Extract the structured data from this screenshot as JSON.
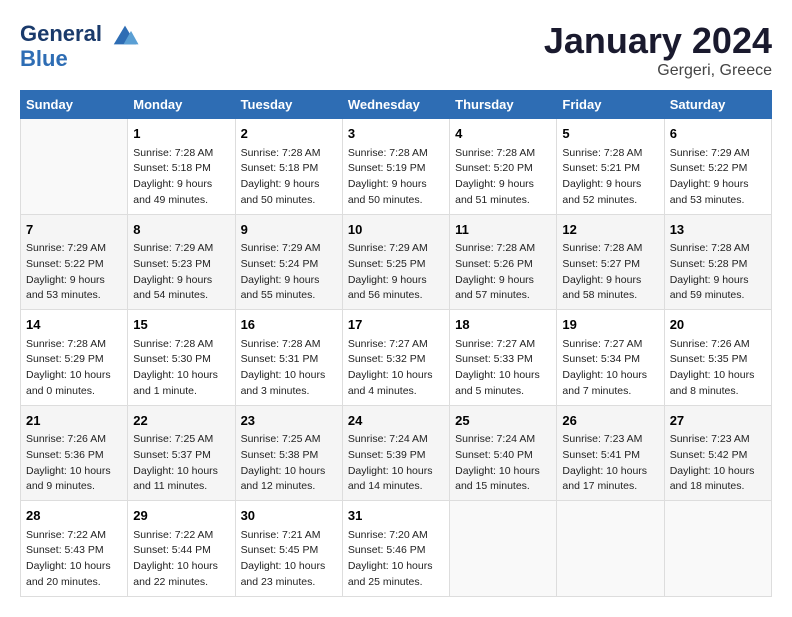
{
  "logo": {
    "line1": "General",
    "line2": "Blue"
  },
  "title": "January 2024",
  "subtitle": "Gergeri, Greece",
  "columns": [
    "Sunday",
    "Monday",
    "Tuesday",
    "Wednesday",
    "Thursday",
    "Friday",
    "Saturday"
  ],
  "weeks": [
    [
      {
        "day": "",
        "content": ""
      },
      {
        "day": "1",
        "content": "Sunrise: 7:28 AM\nSunset: 5:18 PM\nDaylight: 9 hours\nand 49 minutes."
      },
      {
        "day": "2",
        "content": "Sunrise: 7:28 AM\nSunset: 5:18 PM\nDaylight: 9 hours\nand 50 minutes."
      },
      {
        "day": "3",
        "content": "Sunrise: 7:28 AM\nSunset: 5:19 PM\nDaylight: 9 hours\nand 50 minutes."
      },
      {
        "day": "4",
        "content": "Sunrise: 7:28 AM\nSunset: 5:20 PM\nDaylight: 9 hours\nand 51 minutes."
      },
      {
        "day": "5",
        "content": "Sunrise: 7:28 AM\nSunset: 5:21 PM\nDaylight: 9 hours\nand 52 minutes."
      },
      {
        "day": "6",
        "content": "Sunrise: 7:29 AM\nSunset: 5:22 PM\nDaylight: 9 hours\nand 53 minutes."
      }
    ],
    [
      {
        "day": "7",
        "content": "Sunrise: 7:29 AM\nSunset: 5:22 PM\nDaylight: 9 hours\nand 53 minutes."
      },
      {
        "day": "8",
        "content": "Sunrise: 7:29 AM\nSunset: 5:23 PM\nDaylight: 9 hours\nand 54 minutes."
      },
      {
        "day": "9",
        "content": "Sunrise: 7:29 AM\nSunset: 5:24 PM\nDaylight: 9 hours\nand 55 minutes."
      },
      {
        "day": "10",
        "content": "Sunrise: 7:29 AM\nSunset: 5:25 PM\nDaylight: 9 hours\nand 56 minutes."
      },
      {
        "day": "11",
        "content": "Sunrise: 7:28 AM\nSunset: 5:26 PM\nDaylight: 9 hours\nand 57 minutes."
      },
      {
        "day": "12",
        "content": "Sunrise: 7:28 AM\nSunset: 5:27 PM\nDaylight: 9 hours\nand 58 minutes."
      },
      {
        "day": "13",
        "content": "Sunrise: 7:28 AM\nSunset: 5:28 PM\nDaylight: 9 hours\nand 59 minutes."
      }
    ],
    [
      {
        "day": "14",
        "content": "Sunrise: 7:28 AM\nSunset: 5:29 PM\nDaylight: 10 hours\nand 0 minutes."
      },
      {
        "day": "15",
        "content": "Sunrise: 7:28 AM\nSunset: 5:30 PM\nDaylight: 10 hours\nand 1 minute."
      },
      {
        "day": "16",
        "content": "Sunrise: 7:28 AM\nSunset: 5:31 PM\nDaylight: 10 hours\nand 3 minutes."
      },
      {
        "day": "17",
        "content": "Sunrise: 7:27 AM\nSunset: 5:32 PM\nDaylight: 10 hours\nand 4 minutes."
      },
      {
        "day": "18",
        "content": "Sunrise: 7:27 AM\nSunset: 5:33 PM\nDaylight: 10 hours\nand 5 minutes."
      },
      {
        "day": "19",
        "content": "Sunrise: 7:27 AM\nSunset: 5:34 PM\nDaylight: 10 hours\nand 7 minutes."
      },
      {
        "day": "20",
        "content": "Sunrise: 7:26 AM\nSunset: 5:35 PM\nDaylight: 10 hours\nand 8 minutes."
      }
    ],
    [
      {
        "day": "21",
        "content": "Sunrise: 7:26 AM\nSunset: 5:36 PM\nDaylight: 10 hours\nand 9 minutes."
      },
      {
        "day": "22",
        "content": "Sunrise: 7:25 AM\nSunset: 5:37 PM\nDaylight: 10 hours\nand 11 minutes."
      },
      {
        "day": "23",
        "content": "Sunrise: 7:25 AM\nSunset: 5:38 PM\nDaylight: 10 hours\nand 12 minutes."
      },
      {
        "day": "24",
        "content": "Sunrise: 7:24 AM\nSunset: 5:39 PM\nDaylight: 10 hours\nand 14 minutes."
      },
      {
        "day": "25",
        "content": "Sunrise: 7:24 AM\nSunset: 5:40 PM\nDaylight: 10 hours\nand 15 minutes."
      },
      {
        "day": "26",
        "content": "Sunrise: 7:23 AM\nSunset: 5:41 PM\nDaylight: 10 hours\nand 17 minutes."
      },
      {
        "day": "27",
        "content": "Sunrise: 7:23 AM\nSunset: 5:42 PM\nDaylight: 10 hours\nand 18 minutes."
      }
    ],
    [
      {
        "day": "28",
        "content": "Sunrise: 7:22 AM\nSunset: 5:43 PM\nDaylight: 10 hours\nand 20 minutes."
      },
      {
        "day": "29",
        "content": "Sunrise: 7:22 AM\nSunset: 5:44 PM\nDaylight: 10 hours\nand 22 minutes."
      },
      {
        "day": "30",
        "content": "Sunrise: 7:21 AM\nSunset: 5:45 PM\nDaylight: 10 hours\nand 23 minutes."
      },
      {
        "day": "31",
        "content": "Sunrise: 7:20 AM\nSunset: 5:46 PM\nDaylight: 10 hours\nand 25 minutes."
      },
      {
        "day": "",
        "content": ""
      },
      {
        "day": "",
        "content": ""
      },
      {
        "day": "",
        "content": ""
      }
    ]
  ]
}
